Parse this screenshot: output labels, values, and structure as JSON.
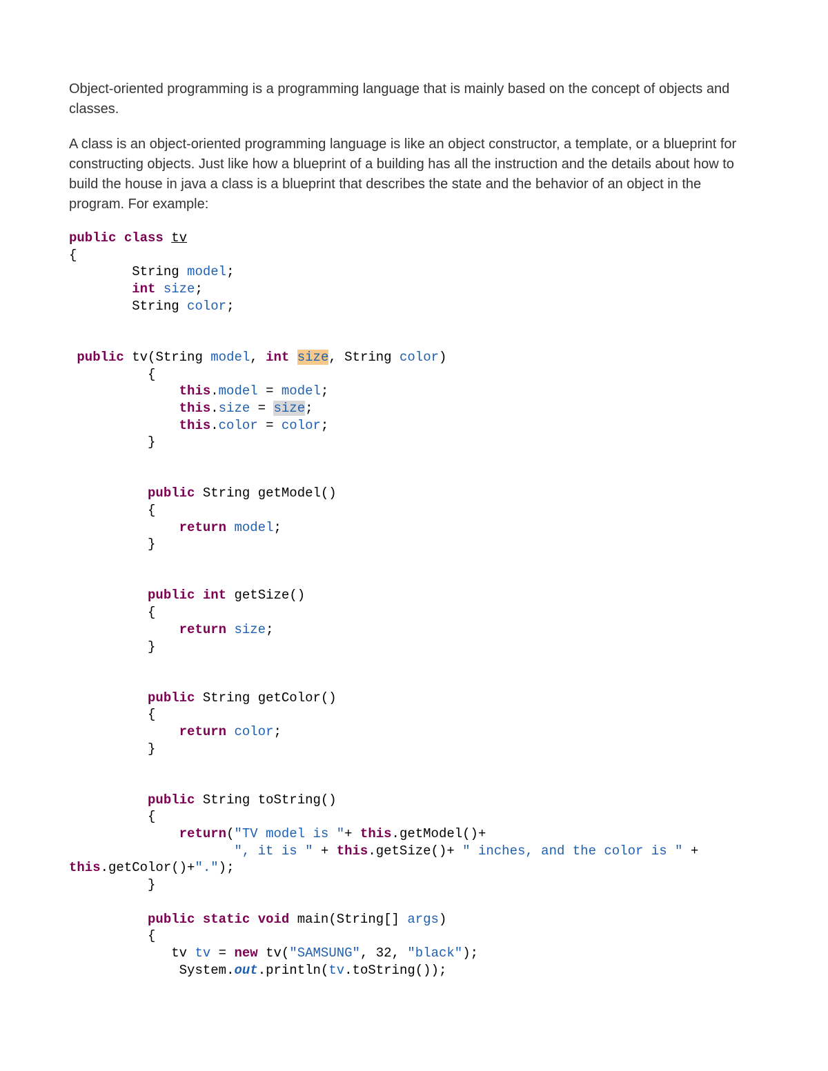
{
  "para1": "Object-oriented programming is a programming language that is mainly based on the concept of objects and classes.",
  "para2": "A class is an object-oriented programming language is like an object constructor, a template, or a blueprint for constructing objects. Just like how a blueprint of a building has all the instruction and the details about how to build the house in java a class is a blueprint that describes the state and the behavior of an object in the program. For example:",
  "code": {
    "kw_public": "public",
    "kw_class": "class",
    "kw_int": "int",
    "kw_return": "return",
    "kw_this": "this",
    "kw_new": "new",
    "kw_static": "static",
    "kw_void": "void",
    "cls_tv": "tv",
    "t_String": "String",
    "f_model": "model",
    "f_size": "size",
    "f_color": "color",
    "semi": ";",
    "lbrace": "{",
    "rbrace": "}",
    "lparen": "(",
    "rparen": ")",
    "comma": ",",
    "dot": ".",
    "sp": " ",
    "eq": "=",
    "plus": "+",
    "m_getModel": "getModel",
    "m_getSize": "getSize",
    "m_getColor": "getColor",
    "m_toString": "toString",
    "m_main": "main",
    "t_Stringarr": "String[]",
    "p_args": "args",
    "v_tv": "tv",
    "t_tv": "tv",
    "s1": "\"TV model is \"",
    "s2": "\", it is \"",
    "s3": "\" inches, and the color is \"",
    "s4": "\".\"",
    "s_samsung": "\"SAMSUNG\"",
    "n_32": "32",
    "s_black": "\"black\"",
    "c_System": "System",
    "c_out": "out",
    "c_println": "println"
  }
}
